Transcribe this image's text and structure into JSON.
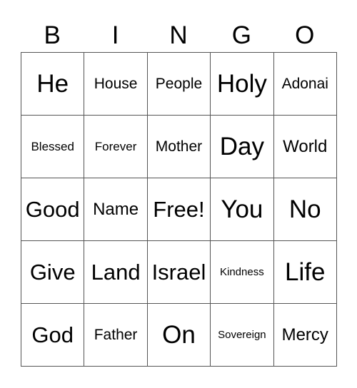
{
  "header": [
    "B",
    "I",
    "N",
    "G",
    "O"
  ],
  "rows": [
    [
      {
        "text": "He",
        "size": "s-xl"
      },
      {
        "text": "House",
        "size": "s-s"
      },
      {
        "text": "People",
        "size": "s-s"
      },
      {
        "text": "Holy",
        "size": "s-xl"
      },
      {
        "text": "Adonai",
        "size": "s-s"
      }
    ],
    [
      {
        "text": "Blessed",
        "size": "s-xs"
      },
      {
        "text": "Forever",
        "size": "s-xs"
      },
      {
        "text": "Mother",
        "size": "s-s"
      },
      {
        "text": "Day",
        "size": "s-xl"
      },
      {
        "text": "World",
        "size": "s-m"
      }
    ],
    [
      {
        "text": "Good",
        "size": "s-l"
      },
      {
        "text": "Name",
        "size": "s-m"
      },
      {
        "text": "Free!",
        "size": "s-l"
      },
      {
        "text": "You",
        "size": "s-xl"
      },
      {
        "text": "No",
        "size": "s-xl"
      }
    ],
    [
      {
        "text": "Give",
        "size": "s-l"
      },
      {
        "text": "Land",
        "size": "s-l"
      },
      {
        "text": "Israel",
        "size": "s-l"
      },
      {
        "text": "Kindness",
        "size": "s-xxs"
      },
      {
        "text": "Life",
        "size": "s-xl"
      }
    ],
    [
      {
        "text": "God",
        "size": "s-l"
      },
      {
        "text": "Father",
        "size": "s-s"
      },
      {
        "text": "On",
        "size": "s-xl"
      },
      {
        "text": "Sovereign",
        "size": "s-xxs"
      },
      {
        "text": "Mercy",
        "size": "s-m"
      }
    ]
  ]
}
